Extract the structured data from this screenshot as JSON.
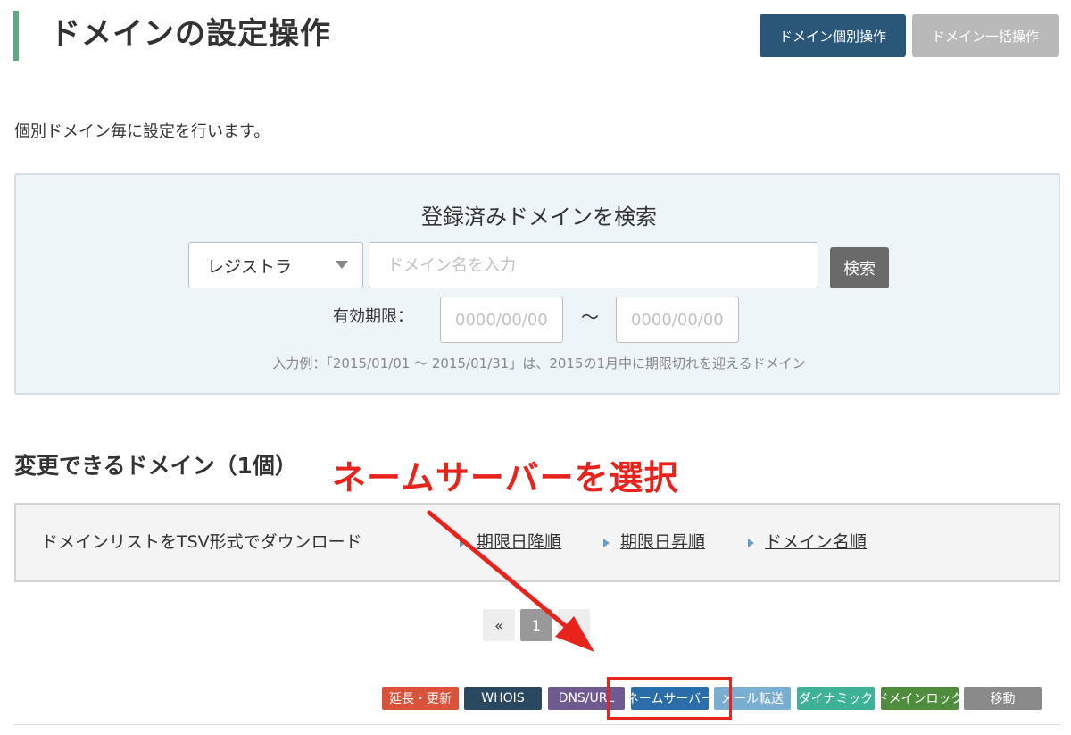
{
  "header": {
    "title": "ドメインの設定操作",
    "individual_button": "ドメイン個別操作",
    "bulk_button": "ドメイン一括操作"
  },
  "description": "個別ドメイン毎に設定を行います。",
  "search": {
    "title": "登録済みドメインを検索",
    "registrar_selected": "レジストラ",
    "domain_placeholder": "ドメイン名を入力",
    "search_button": "検索",
    "expiry_label": "有効期限：",
    "date_from_placeholder": "0000/00/00",
    "date_to_placeholder": "0000/00/00",
    "tilde": "〜",
    "example": "入力例：「2015/01/01 〜 2015/01/31」は、2015の1月中に期限切れを迎えるドメイン"
  },
  "list": {
    "heading": "変更できるドメイン（1個）",
    "tsv_label": "ドメインリストをTSV形式でダウンロード",
    "sort_expiry_desc": "期限日降順",
    "sort_expiry_asc": "期限日昇順",
    "sort_domain": "ドメイン名順"
  },
  "pagination": {
    "prev": "«",
    "current": "1",
    "next": "»"
  },
  "actions": {
    "renew": "延長・更新",
    "whois": "WHOIS",
    "dns_url": "DNS/URL",
    "nameserver": "ネームサーバー",
    "mail_forward": "メール転送",
    "dynamic": "ダイナミック",
    "domain_lock": "ドメインロック",
    "move": "移動"
  },
  "annotation": {
    "text": "ネームサーバーを選択",
    "color": "#e8231b"
  },
  "colors": {
    "title_accent": "#5fa982",
    "primary_button": "#2a5678",
    "search_panel_bg": "#eef5f8"
  },
  "icons": {
    "select_caret": "caret-down-icon",
    "sort_bullet": "triangle-right-icon"
  }
}
